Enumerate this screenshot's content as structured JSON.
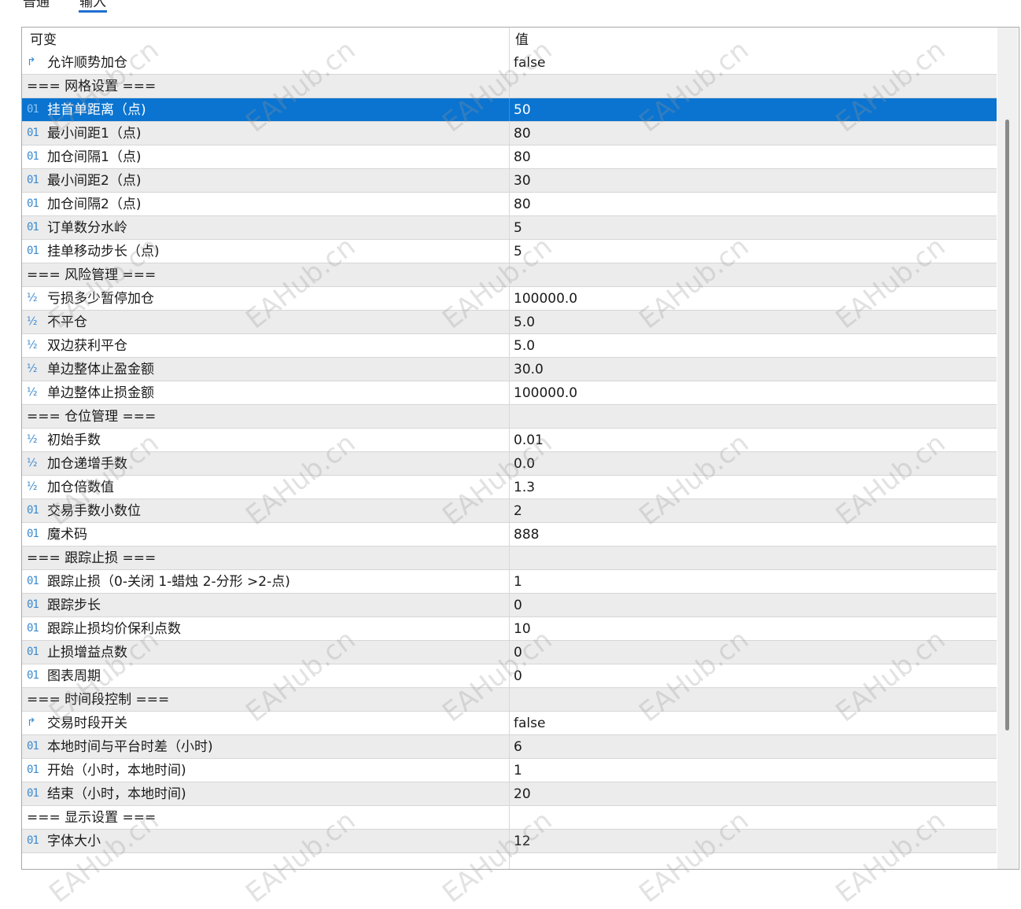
{
  "tabs": [
    {
      "label": "普通"
    },
    {
      "label": "输入"
    }
  ],
  "table": {
    "col_name": "可变",
    "col_value": "值",
    "rows": [
      {
        "kind": "bool",
        "name": "允许顺势加仓",
        "value": "false"
      },
      {
        "kind": "section",
        "name": "=== 网格设置 ===",
        "value": ""
      },
      {
        "kind": "int",
        "name": "挂首单距离（点)",
        "value": "50",
        "selected": true
      },
      {
        "kind": "int",
        "name": "最小间距1（点)",
        "value": "80"
      },
      {
        "kind": "int",
        "name": "加仓间隔1（点)",
        "value": "80"
      },
      {
        "kind": "int",
        "name": "最小间距2（点)",
        "value": "30"
      },
      {
        "kind": "int",
        "name": "加仓间隔2（点)",
        "value": "80"
      },
      {
        "kind": "int",
        "name": "订单数分水岭",
        "value": "5"
      },
      {
        "kind": "int",
        "name": "挂单移动步长（点)",
        "value": "5"
      },
      {
        "kind": "section",
        "name": "=== 风险管理 ===",
        "value": ""
      },
      {
        "kind": "double",
        "name": "亏损多少暂停加仓",
        "value": "100000.0"
      },
      {
        "kind": "double",
        "name": "不平仓",
        "value": "5.0"
      },
      {
        "kind": "double",
        "name": "双边获利平仓",
        "value": "5.0"
      },
      {
        "kind": "double",
        "name": "单边整体止盈金额",
        "value": "30.0"
      },
      {
        "kind": "double",
        "name": "单边整体止损金额",
        "value": "100000.0"
      },
      {
        "kind": "section",
        "name": "=== 仓位管理 ===",
        "value": ""
      },
      {
        "kind": "double",
        "name": "初始手数",
        "value": "0.01"
      },
      {
        "kind": "double",
        "name": "加仓递增手数",
        "value": "0.0"
      },
      {
        "kind": "double",
        "name": "加仓倍数值",
        "value": "1.3"
      },
      {
        "kind": "int",
        "name": "交易手数小数位",
        "value": "2"
      },
      {
        "kind": "int",
        "name": "魔术码",
        "value": "888"
      },
      {
        "kind": "section",
        "name": "=== 跟踪止损 ===",
        "value": ""
      },
      {
        "kind": "int",
        "name": "跟踪止损（0-关闭 1-蜡烛 2-分形 >2-点)",
        "value": "1"
      },
      {
        "kind": "int",
        "name": "跟踪步长",
        "value": "0"
      },
      {
        "kind": "int",
        "name": "跟踪止损均价保利点数",
        "value": "10"
      },
      {
        "kind": "int",
        "name": "止损增益点数",
        "value": "0"
      },
      {
        "kind": "int",
        "name": "图表周期",
        "value": "0"
      },
      {
        "kind": "section",
        "name": "=== 时间段控制 ===",
        "value": ""
      },
      {
        "kind": "bool",
        "name": "交易时段开关",
        "value": "false"
      },
      {
        "kind": "int",
        "name": "本地时间与平台时差（小时)",
        "value": "6"
      },
      {
        "kind": "int",
        "name": "开始（小时，本地时间)",
        "value": "1"
      },
      {
        "kind": "int",
        "name": "结束（小时，本地时间)",
        "value": "20"
      },
      {
        "kind": "section",
        "name": "=== 显示设置 ===",
        "value": ""
      },
      {
        "kind": "int",
        "name": "字体大小",
        "value": "12"
      }
    ]
  },
  "icons": {
    "int": "01",
    "double": "½",
    "bool": "↱"
  },
  "watermark": "EAHub.cn",
  "colors": {
    "selected": "#0a74d0",
    "alt_row": "#ececec",
    "icon_blue": "#3a8ad1",
    "icon_green": "#2eab2e"
  }
}
